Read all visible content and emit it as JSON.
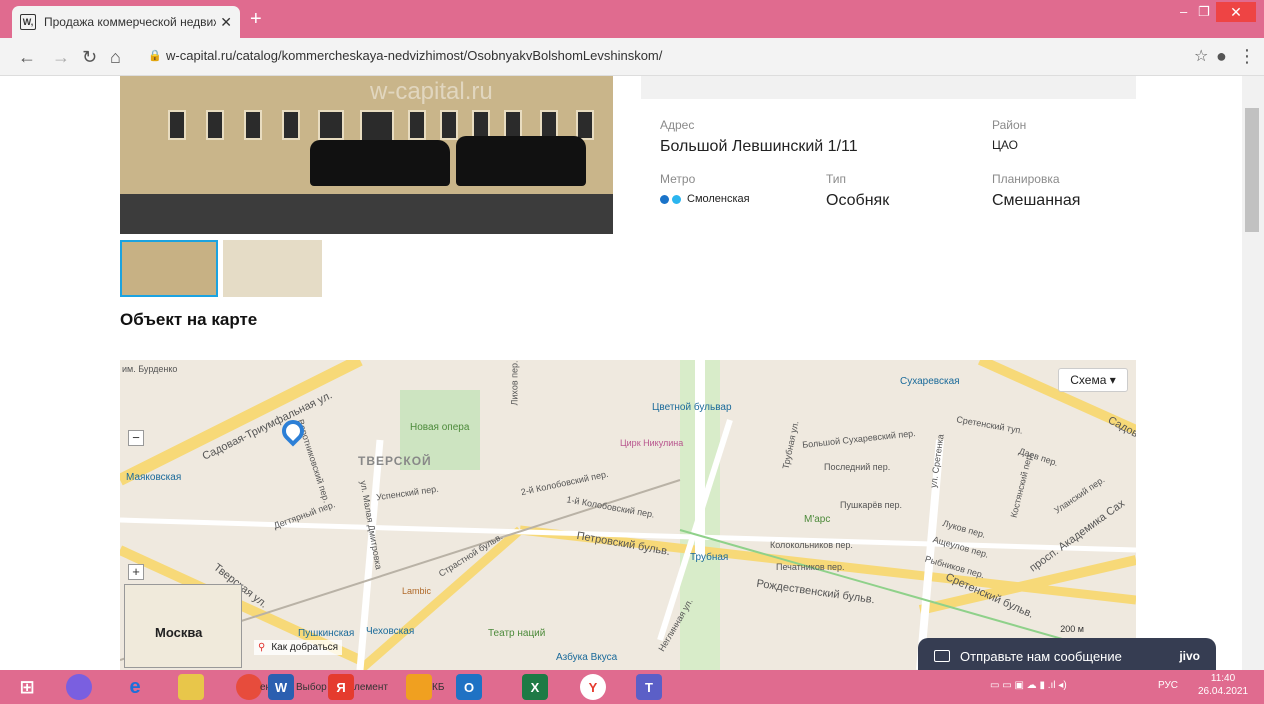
{
  "browser": {
    "tab_title": "Продажа коммерческой недвиж",
    "tab_favicon": "W,",
    "new_tab": "+",
    "url": "w-capital.ru/catalog/kommercheskaya-nedvizhimost/OsobnyakvBolshomLevshinskom/"
  },
  "photo": {
    "watermark": "w-capital.ru"
  },
  "props": {
    "address_label": "Адрес",
    "address_value": "Большой Левшинский 1/11",
    "district_label": "Район",
    "district_value": "ЦАО",
    "metro_label": "Метро",
    "metro_value": "Смоленская",
    "type_label": "Тип",
    "type_value": "Особняк",
    "layout_label": "Планировка",
    "layout_value": "Смешанная"
  },
  "map_title": "Объект на карте",
  "map": {
    "schema_button": "Схема ▾",
    "route": "Как добраться",
    "minimap_city": "Москва",
    "scale": "200 м",
    "labels": {
      "burdenko": "им. Бурденко",
      "sadovaya_triumf": "Садовая-Триумфальная ул.",
      "sadovaya": "Садовая",
      "mayakovskaya": "Маяковская",
      "tverskoy": "ТВЕРСКОЙ",
      "novaya_opera": "Новая опера",
      "tsvetnoy": "Цветной бульвар",
      "tsirk": "Цирк Никулина",
      "sukharevskaya": "Сухаревская",
      "vorotnikovsky": "Воротниковский пер.",
      "uspensky": "Успенский пер.",
      "kolobovsky2": "2-й Колобовский пер.",
      "kolobovsky1": "1-й Колобовский пер.",
      "degtyarny": "Дегтярный пер.",
      "malaya_dmitrovka": "ул. Малая Дмитровка",
      "strastnoy": "Страстной бульв.",
      "petrovsky": "Петровский бульв.",
      "trubnaya": "Трубная",
      "tverskaya": "Тверская ул.",
      "lambic": "Lambic",
      "pushkinskaya": "Пушкинская",
      "chekhovskaya": "Чеховская",
      "teatr": "Театр наций",
      "azbuka": "Азбука Вкуса",
      "bolshoy_sukharevsky": "Большой Сухаревский пер.",
      "posledny": "Последний пер.",
      "pushkarev": "Пушкарёв пер.",
      "marc": "М'арс",
      "kolokolnikov": "Колокольников пер.",
      "pechatnikov": "Печатников пер.",
      "rozhdestvensky": "Рождественский бульв.",
      "sretenka": "ул. Сретенка",
      "sretensky_tup": "Сретенский туп.",
      "daev": "Даев пер.",
      "lukov": "Луков пер.",
      "ashcheulov": "Ащеулов пер.",
      "rybnikov": "Рыбников пер.",
      "sretensky_bulv": "Сретенский бульв.",
      "akademika": "просп. Академика Сах",
      "ulansky": "Уланский пер.",
      "likhov": "Лихов пер.",
      "neglinnaya": "Неглинная ул.",
      "trubnaya_ul": "Трубная ул.",
      "kostyansky": "Костянский пер."
    }
  },
  "jivo": {
    "text": "Отправьте нам сообщение",
    "brand": "jivo"
  },
  "taskbar": {
    "items": [
      "ентов",
      "Выбор",
      "лемент",
      "КБ"
    ],
    "lang": "РУС",
    "time": "11:40",
    "date": "26.04.2021"
  },
  "colors": {
    "accent": "#e06b8f",
    "metro_dark": "#1a73c9",
    "metro_light": "#2bb5ef",
    "jivo": "#363d52"
  }
}
